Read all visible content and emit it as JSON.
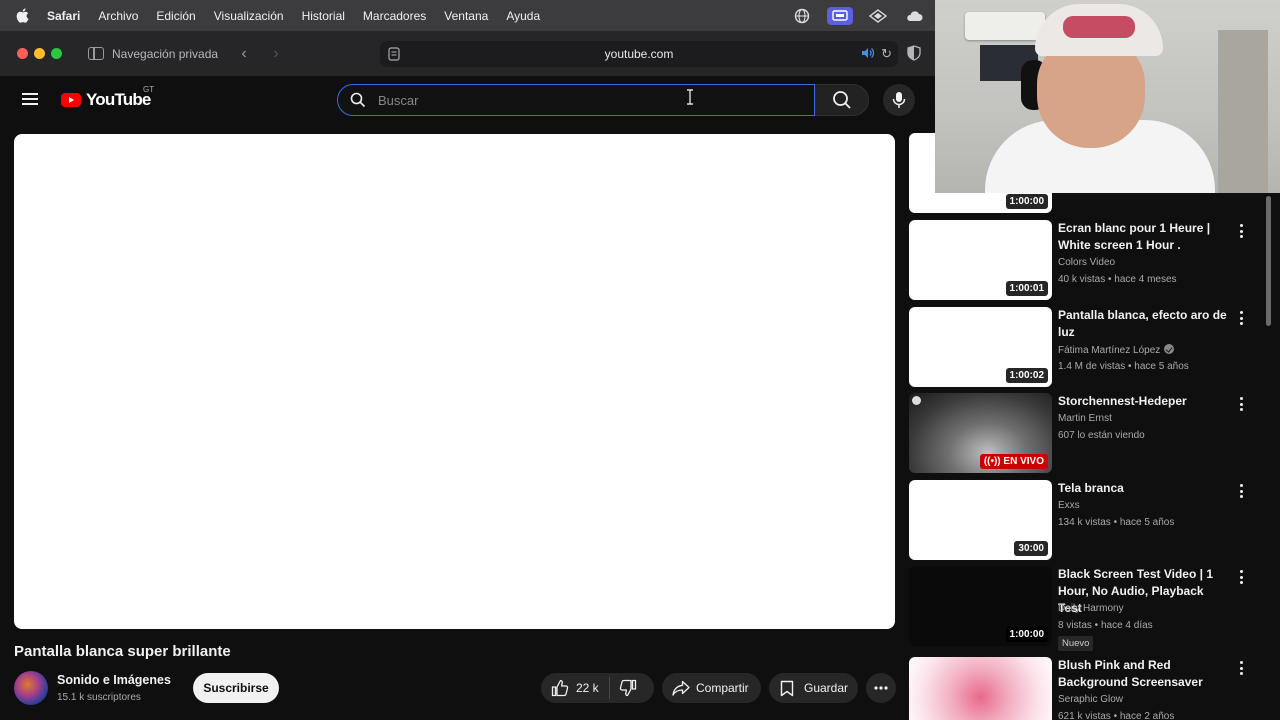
{
  "menubar": {
    "items": [
      "Safari",
      "Archivo",
      "Edición",
      "Visualización",
      "Historial",
      "Marcadores",
      "Ventana",
      "Ayuda"
    ]
  },
  "browser": {
    "private_label": "Navegación privada",
    "url": "youtube.com"
  },
  "youtube": {
    "logo_text": "YouTube",
    "country_code": "GT",
    "search_placeholder": "Buscar"
  },
  "video": {
    "title": "Pantalla blanca super brillante",
    "channel": "Sonido e Imágenes",
    "subscribers": "15.1 k suscriptores",
    "subscribe_label": "Suscribirse",
    "likes": "22 k",
    "share_label": "Compartir",
    "save_label": "Guardar"
  },
  "recommendations": [
    {
      "title": "",
      "channel": "",
      "meta": "",
      "duration": "1:00:00",
      "thumb": "white"
    },
    {
      "title": "Ecran blanc pour 1 Heure | White screen 1 Hour .",
      "channel": "Colors Video",
      "meta": "40 k vistas • hace 4 meses",
      "duration": "1:00:01",
      "thumb": "white"
    },
    {
      "title": "Pantalla blanca, efecto aro de luz",
      "channel": "Fátima Martínez López",
      "meta": "1.4 M de vistas • hace 5 años",
      "duration": "1:00:02",
      "thumb": "white",
      "verified": true
    },
    {
      "title": "Storchennest-Hedeper",
      "channel": "Martin Ernst",
      "meta": "607 lo están viendo",
      "live_label": "EN VIVO",
      "thumb": "cam"
    },
    {
      "title": "Tela branca",
      "channel": "Exxs",
      "meta": "134 k vistas • hace 5 años",
      "duration": "30:00",
      "thumb": "white"
    },
    {
      "title": "Black Screen Test Video | 1 Hour, No Audio, Playback Test",
      "channel": "Daily Harmony",
      "meta": "8 vistas • hace 4 días",
      "duration": "1:00:00",
      "badge": "Nuevo",
      "thumb": "dark"
    },
    {
      "title": "Blush Pink and Red Background Screensaver",
      "channel": "Seraphic Glow",
      "meta": "621 k vistas • hace 2 años",
      "thumb": "pink"
    }
  ],
  "colors": {
    "youtube_red": "#ff0000",
    "search_focus": "#3a6dd8",
    "live_red": "#cc0000"
  }
}
